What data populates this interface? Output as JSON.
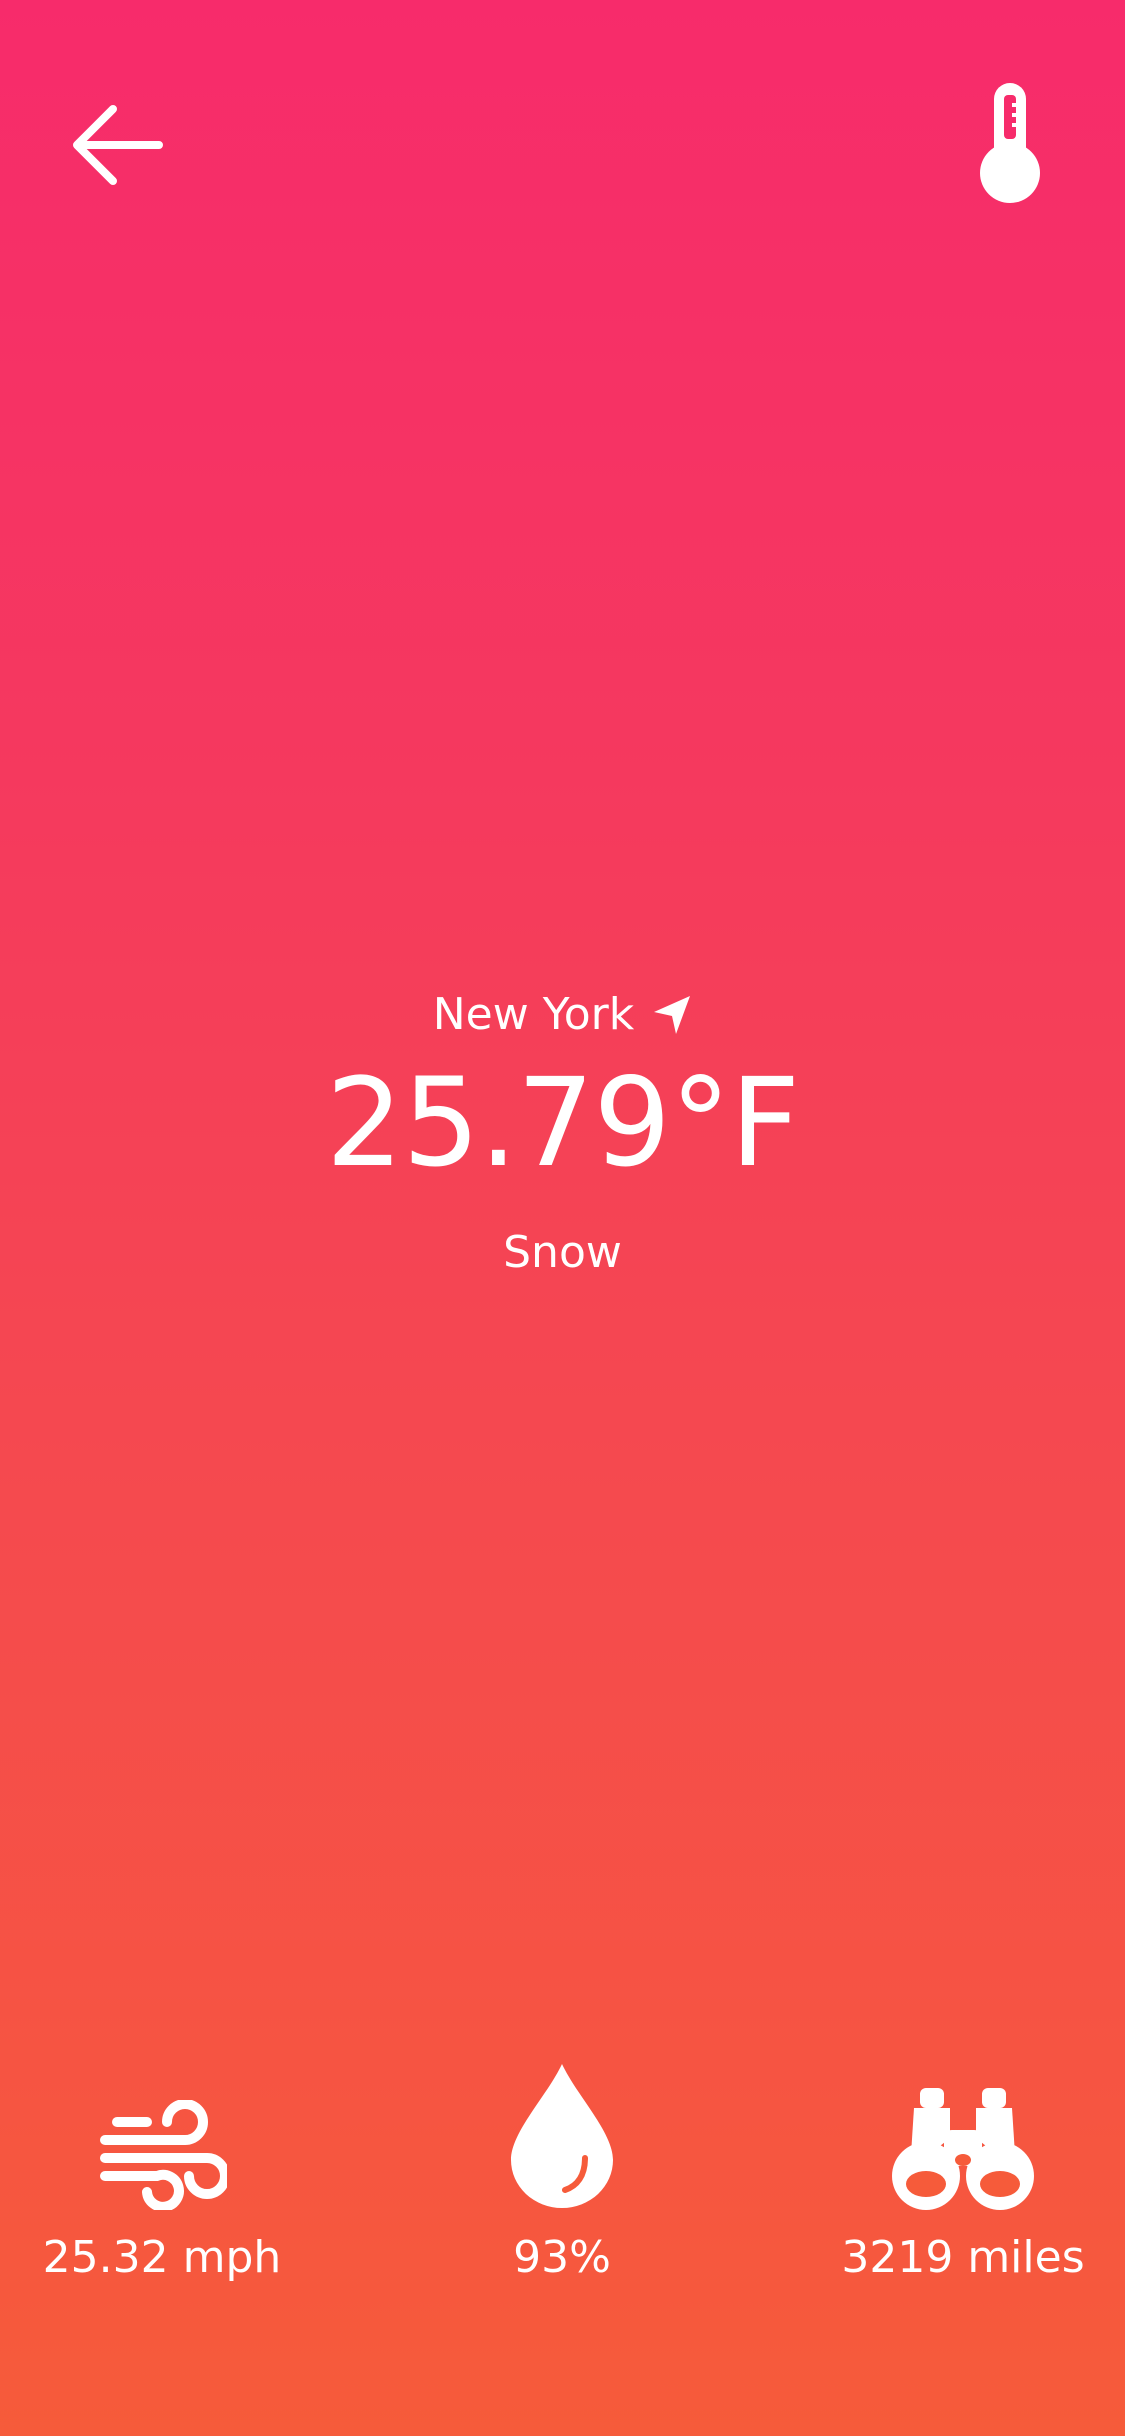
{
  "header": {
    "back_icon": "arrow-left-icon",
    "units_icon": "thermometer-icon"
  },
  "weather": {
    "city": "New York",
    "location_icon": "location-arrow-icon",
    "temperature": "25.79°F",
    "condition": "Snow"
  },
  "stats": {
    "wind": {
      "icon": "wind-icon",
      "value": "25.32 mph"
    },
    "humidity": {
      "icon": "water-drop-icon",
      "value": "93%"
    },
    "visibility": {
      "icon": "binoculars-icon",
      "value": "3219 miles"
    }
  },
  "colors": {
    "gradient_top": "#f72b6b",
    "gradient_bottom": "#f65b3a",
    "foreground": "#ffffff"
  }
}
